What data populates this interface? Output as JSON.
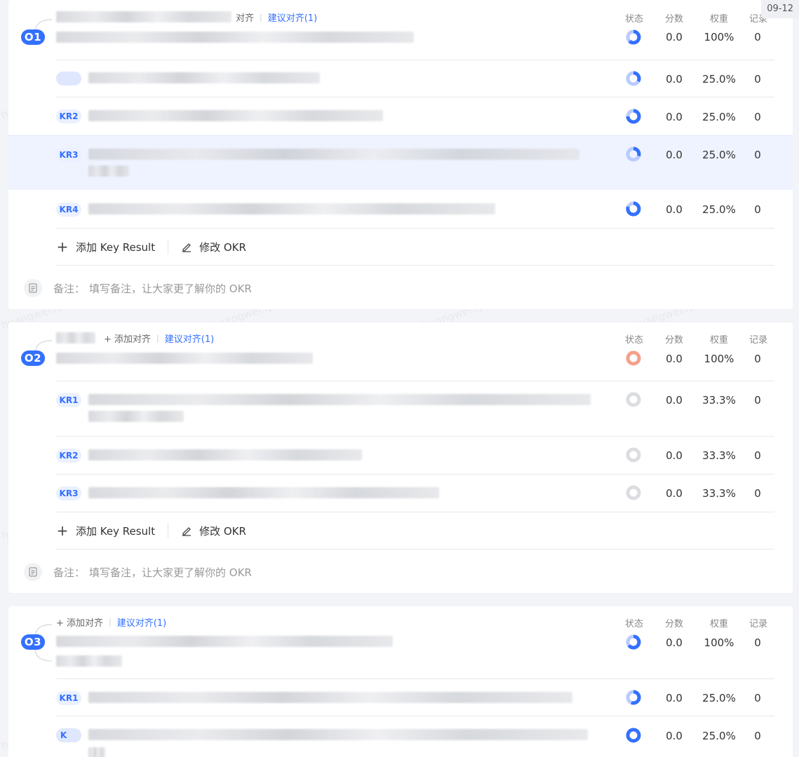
{
  "date_badge": "09-12",
  "columns": {
    "status": "状态",
    "score": "分数",
    "weight": "权重",
    "records": "记录"
  },
  "watermark": {
    "user": "huangwei.fps",
    "name": "黄巍"
  },
  "actions": {
    "add_kr": "添加 Key Result",
    "edit_okr": "修改 OKR"
  },
  "note": {
    "label": "备注：",
    "placeholder": "填写备注，让大家更了解你的 OKR"
  },
  "align": {
    "add": "添加对齐",
    "suggest": "建议对齐(1)",
    "partial_add": "对齐"
  },
  "colors": {
    "accent": "#3370ff",
    "status_blue": "#3370ff",
    "status_orange": "#f27b5b",
    "status_gray": "#cfd1d6"
  },
  "objectives": [
    {
      "badge": "O1",
      "score": "0.0",
      "weight": "100%",
      "records": "0",
      "krs": [
        {
          "tag": "",
          "score": "0.0",
          "weight": "25.0%",
          "records": "0"
        },
        {
          "tag": "KR2",
          "score": "0.0",
          "weight": "25.0%",
          "records": "0"
        },
        {
          "tag": "KR3",
          "score": "0.0",
          "weight": "25.0%",
          "records": "0"
        },
        {
          "tag": "KR4",
          "score": "0.0",
          "weight": "25.0%",
          "records": "0"
        }
      ]
    },
    {
      "badge": "O2",
      "score": "0.0",
      "weight": "100%",
      "records": "0",
      "krs": [
        {
          "tag": "KR1",
          "score": "0.0",
          "weight": "33.3%",
          "records": "0"
        },
        {
          "tag": "KR2",
          "score": "0.0",
          "weight": "33.3%",
          "records": "0"
        },
        {
          "tag": "KR3",
          "score": "0.0",
          "weight": "33.3%",
          "records": "0"
        }
      ]
    },
    {
      "badge": "O3",
      "score": "0.0",
      "weight": "100%",
      "records": "0",
      "krs": [
        {
          "tag": "KR1",
          "score": "0.0",
          "weight": "25.0%",
          "records": "0"
        },
        {
          "tag": "K",
          "score": "0.0",
          "weight": "25.0%",
          "records": "0"
        }
      ]
    }
  ]
}
